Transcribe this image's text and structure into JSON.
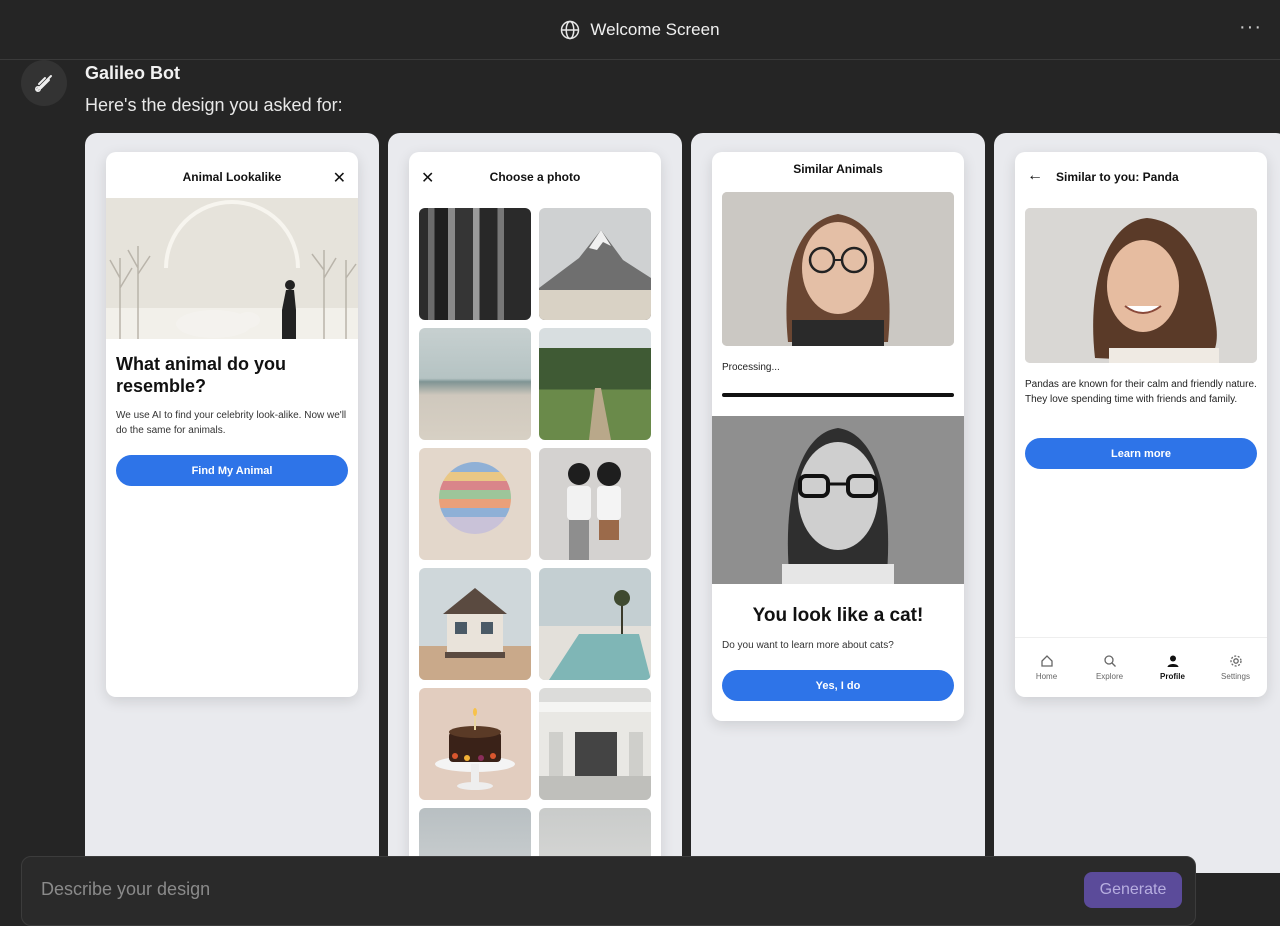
{
  "header": {
    "title": "Welcome Screen",
    "more": "···"
  },
  "bot": {
    "name": "Galileo Bot",
    "message": "Here's the design you asked for:"
  },
  "screen1": {
    "header_title": "Animal Lookalike",
    "heading": "What animal do you resemble?",
    "body": "We use AI to find your celebrity look-alike. Now we'll do the same for animals.",
    "button": "Find My Animal"
  },
  "screen2": {
    "header_title": "Choose a photo"
  },
  "screen3": {
    "header_title": "Similar Animals",
    "status": "Processing...",
    "result_heading": "You look like a cat!",
    "question": "Do you want to learn more about cats?",
    "button": "Yes, I do"
  },
  "screen4": {
    "header_title": "Similar to you: Panda",
    "body": "Pandas are known for their calm and friendly nature. They love spending time with friends and family.",
    "button": "Learn more",
    "nav": [
      {
        "label": "Home",
        "icon": "home-icon"
      },
      {
        "label": "Explore",
        "icon": "search-icon"
      },
      {
        "label": "Profile",
        "icon": "person-icon"
      },
      {
        "label": "Settings",
        "icon": "gear-icon"
      }
    ]
  },
  "input": {
    "placeholder": "Describe your design",
    "button": "Generate"
  },
  "colors": {
    "accent": "#2e74e8",
    "generate": "#5b4b9a"
  }
}
